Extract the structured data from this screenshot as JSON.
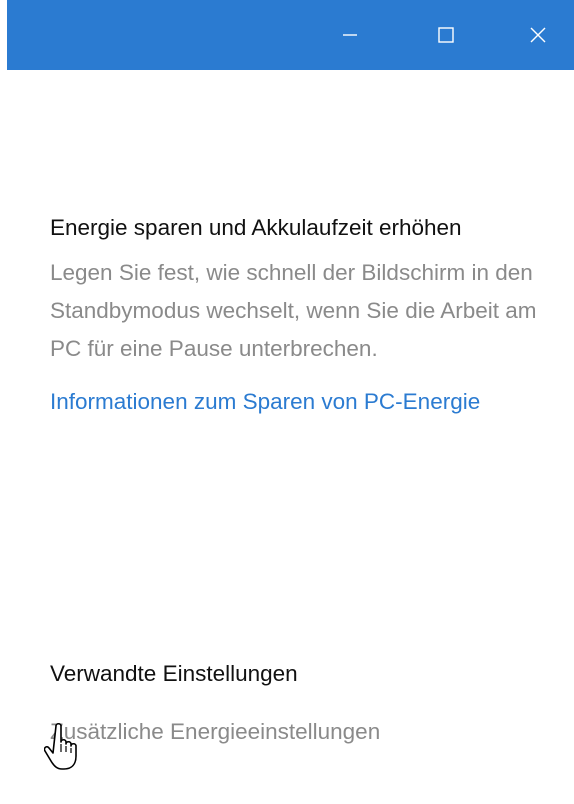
{
  "window": {
    "titlebar_color": "#2b7bd1",
    "controls": {
      "minimize_icon": "minimize-icon",
      "maximize_icon": "maximize-icon",
      "close_icon": "close-icon"
    }
  },
  "power": {
    "heading": "Energie sparen und Akkulaufzeit erhöhen",
    "description": "Legen Sie fest, wie schnell der Bildschirm in den Standbymodus wechselt, wenn Sie die Arbeit am PC für eine Pause unterbrechen.",
    "link": "Informationen zum Sparen von PC-Energie"
  },
  "related": {
    "heading": "Verwandte Einstellungen",
    "link": "Zusätzliche Energieeinstellungen"
  },
  "colors": {
    "accent": "#2b7bd1",
    "secondary_text": "#8a8a8a"
  }
}
